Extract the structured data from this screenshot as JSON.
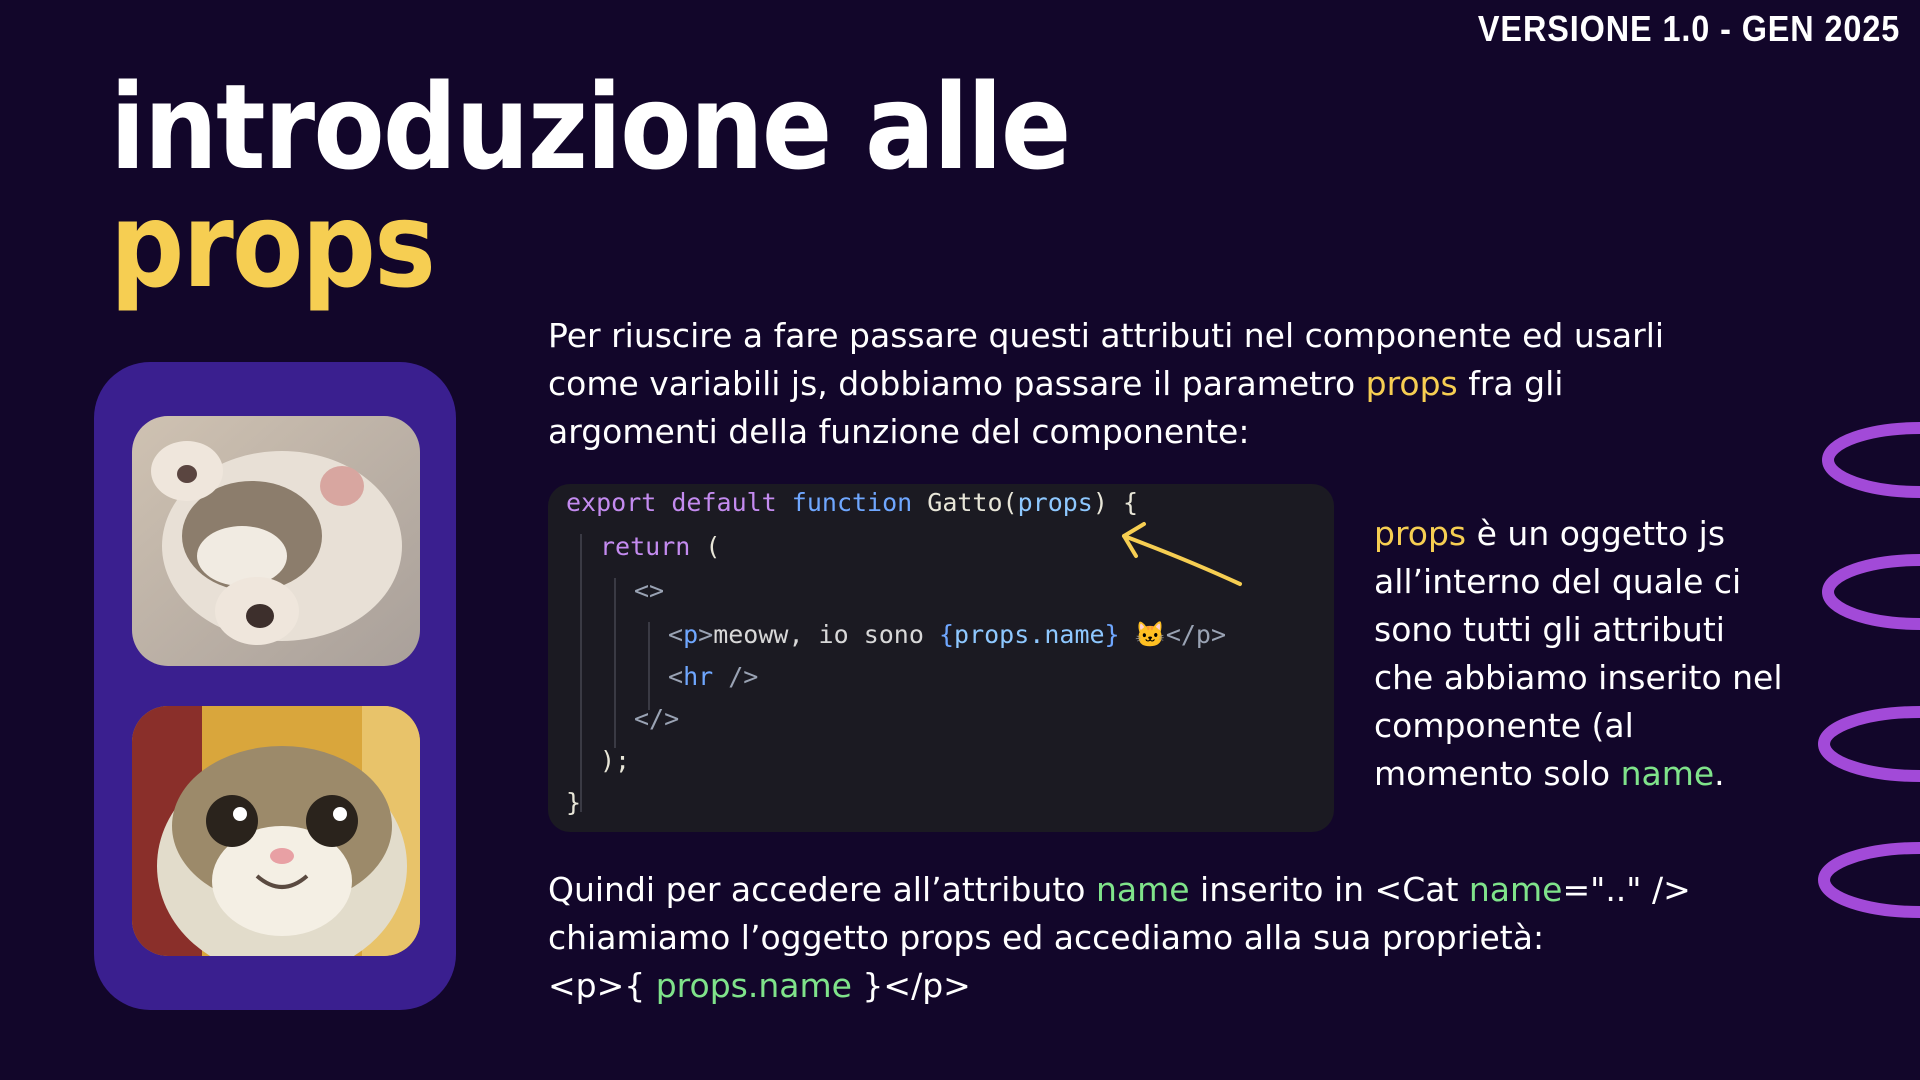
{
  "header": {
    "version": "VERSIONE 1.0 - GEN 2025"
  },
  "title": {
    "line1": "introduzione alle",
    "line2": "props"
  },
  "intro": {
    "before": "Per riuscire a fare passare questi attributi nel componente ed usarli come variabili js, dobbiamo passare il parametro ",
    "highlight": "props",
    "after": " fra gli argomenti della funzione del componente:"
  },
  "code": {
    "line1": {
      "kw1": "export",
      "kw2": "default",
      "kw3": "function",
      "name": "Gatto(",
      "param": "props",
      "close": ") {"
    },
    "line2": {
      "kw": "return",
      "rest": " ("
    },
    "line3": "<>",
    "line4": {
      "open_lt": "<",
      "tag": "p",
      "open_gt": ">",
      "text": "meoww, io sono ",
      "brace_open": "{",
      "expr": "props.name",
      "brace_close": "}",
      "emoji": "🐱",
      "close": "</p>"
    },
    "line5": {
      "lt": "<",
      "tag": "hr",
      "rest": " />"
    },
    "line6": "</>",
    "line7": ");",
    "line8": "}"
  },
  "side_note": {
    "hl1": "props",
    "text1": " è un oggetto js all’interno del quale ci sono tutti gli attributi che abbiamo inserito nel componente (al momento solo ",
    "hl2": "name",
    "text2": "."
  },
  "bottom": {
    "t1": "Quindi per accedere all’attributo ",
    "hl1": "name",
    "t2": " inserito in <Cat ",
    "hl2": "name",
    "t3": "=\"..\" />",
    "t4": "chiamiamo l’oggetto props ed accediamo alla sua proprietà:",
    "t5": "<p>{ ",
    "hl3": "props.name",
    "t6": " }</p>"
  },
  "photos": {
    "first": "sleeping-kitten-photo",
    "second": "smiling-cat-photo"
  },
  "colors": {
    "background": "#12062a",
    "accent_yellow": "#f6ce52",
    "accent_green": "#7fe38a",
    "card_purple": "#3a1f8f",
    "deco_purple": "#a24ad8"
  }
}
